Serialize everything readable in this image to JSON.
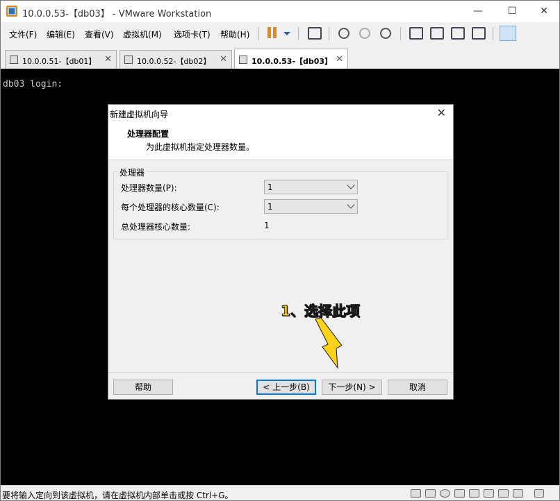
{
  "window": {
    "title": "10.0.0.53-【db03】 - VMware Workstation",
    "minimize": "—",
    "maximize": "☐",
    "close": "✕"
  },
  "menu": {
    "items": [
      "文件(F)",
      "编辑(E)",
      "查看(V)",
      "虚拟机(M)",
      "选项卡(T)",
      "帮助(H)"
    ]
  },
  "tabs": [
    {
      "label": "10.0.0.51-【db01】",
      "close": "✕"
    },
    {
      "label": "10.0.0.52-【db02】",
      "close": "✕"
    },
    {
      "label": "10.0.0.53-【db03】",
      "close": "✕"
    }
  ],
  "console": {
    "text": "db03 login:"
  },
  "dialog": {
    "title": "新建虚拟机向导",
    "close": "✕",
    "header_title": "处理器配置",
    "header_subtitle": "为此虚拟机指定处理器数量。",
    "group_label": "处理器",
    "processor_count_label": "处理器数量(P):",
    "processor_count_value": "1",
    "cores_per_processor_label": "每个处理器的核心数量(C):",
    "cores_per_processor_value": "1",
    "total_cores_label": "总处理器核心数量:",
    "total_cores_value": "1",
    "buttons": {
      "help": "帮助",
      "back": "< 上一步(B)",
      "next": "下一步(N) >",
      "cancel": "取消"
    }
  },
  "annotation": {
    "text": "1、选择此项",
    "color": "#ffd319"
  },
  "status": {
    "text": "要将输入定向到该虚拟机，请在虚拟机内部单击或按 Ctrl+G。"
  }
}
